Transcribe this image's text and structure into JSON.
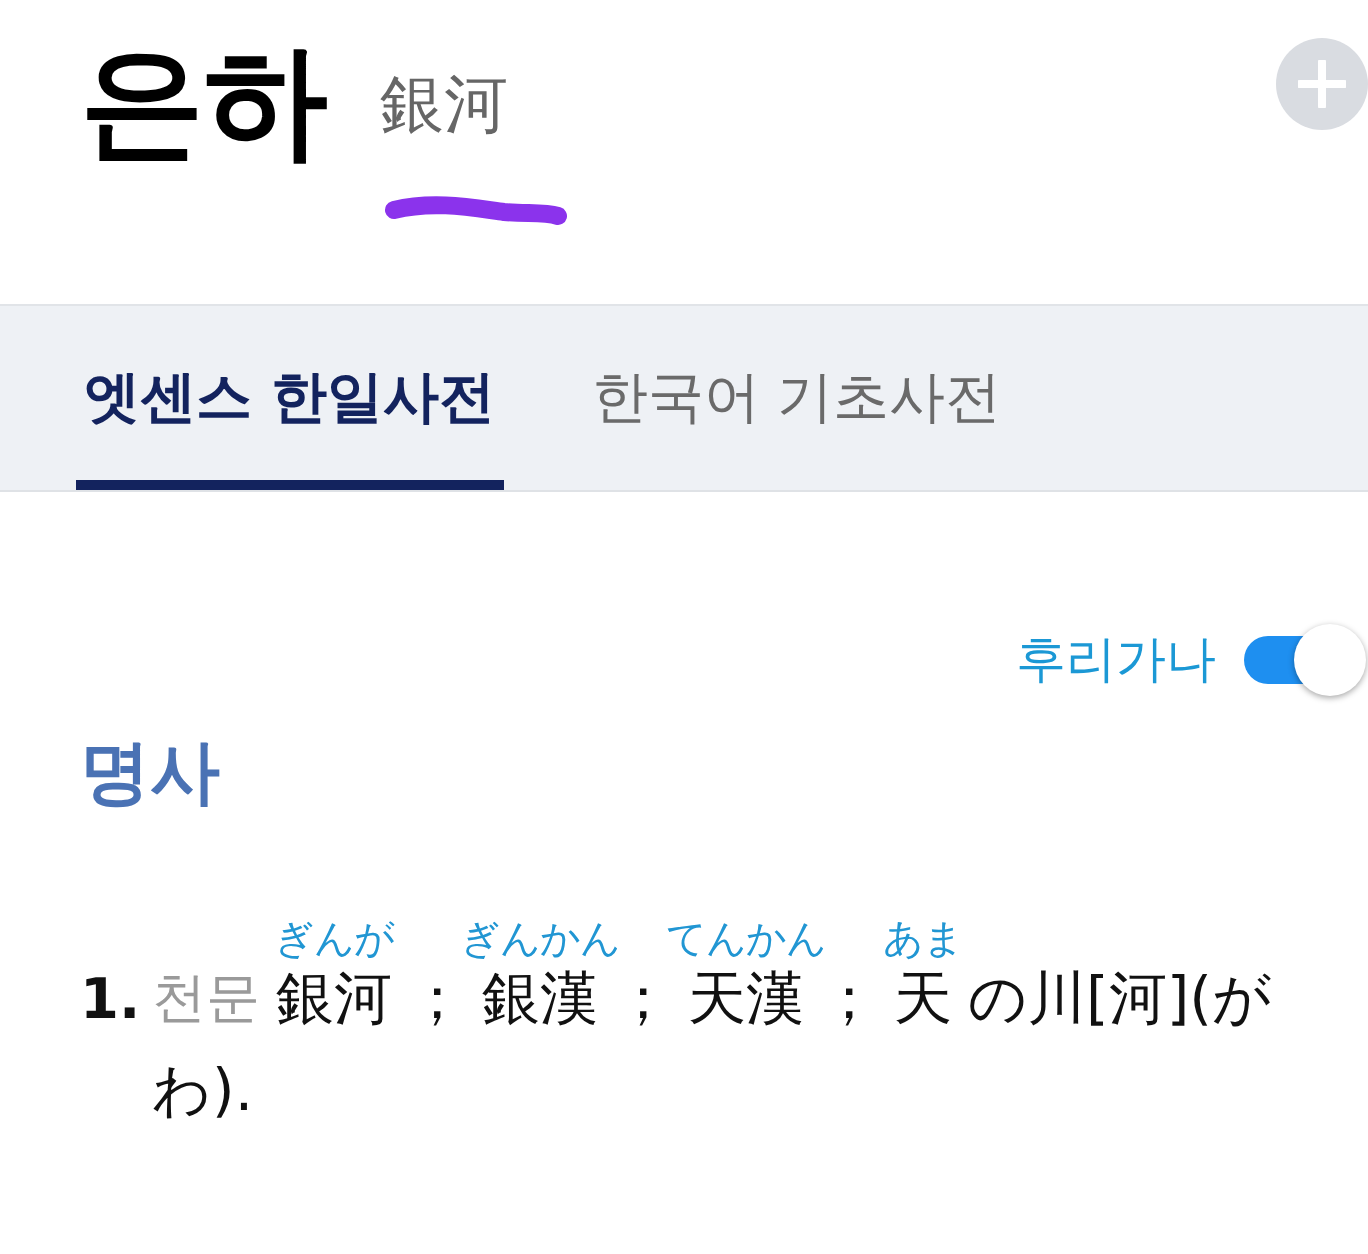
{
  "entry": {
    "headword": "은하",
    "hanja": "銀河"
  },
  "tabs": [
    {
      "label": "엣센스 한일사전",
      "selected": true
    },
    {
      "label": "한국어 기초사전",
      "selected": false
    }
  ],
  "furigana_toggle": {
    "label": "후리가나",
    "on": true
  },
  "part_of_speech": "명사",
  "senses": [
    {
      "number": "1.",
      "domain": "천문",
      "segments": [
        {
          "text": "銀河",
          "reading": "ぎんが"
        },
        {
          "text": "；"
        },
        {
          "text": "銀漢",
          "reading": "ぎんかん"
        },
        {
          "text": "；"
        },
        {
          "text": "天漢",
          "reading": "てんかん"
        },
        {
          "text": "；"
        },
        {
          "text": "天",
          "reading": "あま"
        },
        {
          "text": "の川[河](が"
        },
        {
          "text": "わ)."
        }
      ]
    }
  ]
}
